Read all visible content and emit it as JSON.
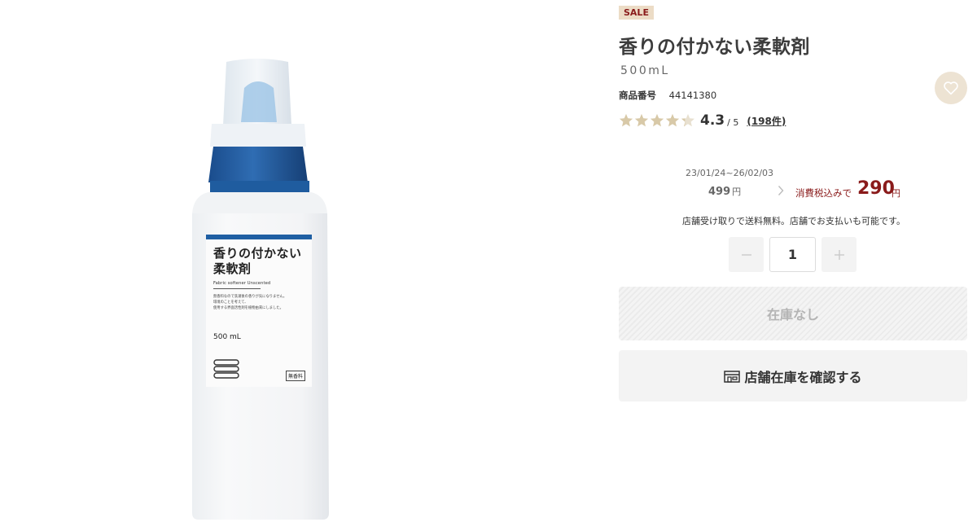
{
  "image": {
    "label_name_line1": "香りの付かない",
    "label_name_line2": "柔軟剤",
    "label_subtitle": "Fabric softener Unscented",
    "label_description": "無香料なので洗濯後の香りが気になりません。\n環境のことを考えて、\n使用する界面活性剤を植物由来にしました。",
    "label_volume": "500 mL",
    "label_badge": "無香料"
  },
  "product": {
    "sale_badge": "SALE",
    "title": "香りの付かない柔軟剤",
    "volume": "500mL",
    "sku_label": "商品番号",
    "sku_value": "44141380"
  },
  "rating": {
    "value": "4.3",
    "max": "/ 5",
    "count": "(198件)",
    "stars_filled": 4.3,
    "star_color": "#d8c9a8",
    "star_empty_color": "#e8e0d0"
  },
  "pricing": {
    "sale_period": "23/01/24~26/02/03",
    "regular_price": "499",
    "regular_price_unit": "円",
    "tax_label": "消費税込みで",
    "sale_price": "290",
    "sale_price_unit": "円",
    "accent_color": "#8a1b1b"
  },
  "shipping_note": "店舗受け取りで送料無料。店舗でお支払いも可能です。",
  "quantity": {
    "value": "1"
  },
  "actions": {
    "stock_label": "在庫なし",
    "store_stock_label": "店舗在庫を確認する"
  },
  "icons": {
    "favorite": "heart-icon",
    "minus": "minus-icon",
    "plus": "plus-icon",
    "store": "store-icon",
    "arrow": "chevron-right-icon"
  }
}
